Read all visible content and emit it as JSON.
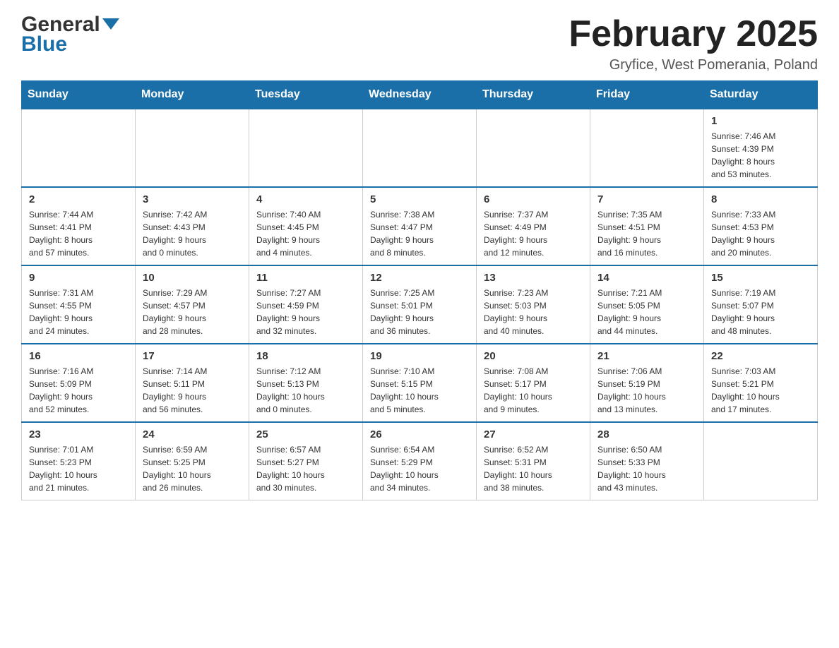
{
  "header": {
    "logo_general": "General",
    "logo_blue": "Blue",
    "title": "February 2025",
    "subtitle": "Gryfice, West Pomerania, Poland"
  },
  "weekdays": [
    "Sunday",
    "Monday",
    "Tuesday",
    "Wednesday",
    "Thursday",
    "Friday",
    "Saturday"
  ],
  "weeks": [
    [
      {
        "day": "",
        "info": ""
      },
      {
        "day": "",
        "info": ""
      },
      {
        "day": "",
        "info": ""
      },
      {
        "day": "",
        "info": ""
      },
      {
        "day": "",
        "info": ""
      },
      {
        "day": "",
        "info": ""
      },
      {
        "day": "1",
        "info": "Sunrise: 7:46 AM\nSunset: 4:39 PM\nDaylight: 8 hours\nand 53 minutes."
      }
    ],
    [
      {
        "day": "2",
        "info": "Sunrise: 7:44 AM\nSunset: 4:41 PM\nDaylight: 8 hours\nand 57 minutes."
      },
      {
        "day": "3",
        "info": "Sunrise: 7:42 AM\nSunset: 4:43 PM\nDaylight: 9 hours\nand 0 minutes."
      },
      {
        "day": "4",
        "info": "Sunrise: 7:40 AM\nSunset: 4:45 PM\nDaylight: 9 hours\nand 4 minutes."
      },
      {
        "day": "5",
        "info": "Sunrise: 7:38 AM\nSunset: 4:47 PM\nDaylight: 9 hours\nand 8 minutes."
      },
      {
        "day": "6",
        "info": "Sunrise: 7:37 AM\nSunset: 4:49 PM\nDaylight: 9 hours\nand 12 minutes."
      },
      {
        "day": "7",
        "info": "Sunrise: 7:35 AM\nSunset: 4:51 PM\nDaylight: 9 hours\nand 16 minutes."
      },
      {
        "day": "8",
        "info": "Sunrise: 7:33 AM\nSunset: 4:53 PM\nDaylight: 9 hours\nand 20 minutes."
      }
    ],
    [
      {
        "day": "9",
        "info": "Sunrise: 7:31 AM\nSunset: 4:55 PM\nDaylight: 9 hours\nand 24 minutes."
      },
      {
        "day": "10",
        "info": "Sunrise: 7:29 AM\nSunset: 4:57 PM\nDaylight: 9 hours\nand 28 minutes."
      },
      {
        "day": "11",
        "info": "Sunrise: 7:27 AM\nSunset: 4:59 PM\nDaylight: 9 hours\nand 32 minutes."
      },
      {
        "day": "12",
        "info": "Sunrise: 7:25 AM\nSunset: 5:01 PM\nDaylight: 9 hours\nand 36 minutes."
      },
      {
        "day": "13",
        "info": "Sunrise: 7:23 AM\nSunset: 5:03 PM\nDaylight: 9 hours\nand 40 minutes."
      },
      {
        "day": "14",
        "info": "Sunrise: 7:21 AM\nSunset: 5:05 PM\nDaylight: 9 hours\nand 44 minutes."
      },
      {
        "day": "15",
        "info": "Sunrise: 7:19 AM\nSunset: 5:07 PM\nDaylight: 9 hours\nand 48 minutes."
      }
    ],
    [
      {
        "day": "16",
        "info": "Sunrise: 7:16 AM\nSunset: 5:09 PM\nDaylight: 9 hours\nand 52 minutes."
      },
      {
        "day": "17",
        "info": "Sunrise: 7:14 AM\nSunset: 5:11 PM\nDaylight: 9 hours\nand 56 minutes."
      },
      {
        "day": "18",
        "info": "Sunrise: 7:12 AM\nSunset: 5:13 PM\nDaylight: 10 hours\nand 0 minutes."
      },
      {
        "day": "19",
        "info": "Sunrise: 7:10 AM\nSunset: 5:15 PM\nDaylight: 10 hours\nand 5 minutes."
      },
      {
        "day": "20",
        "info": "Sunrise: 7:08 AM\nSunset: 5:17 PM\nDaylight: 10 hours\nand 9 minutes."
      },
      {
        "day": "21",
        "info": "Sunrise: 7:06 AM\nSunset: 5:19 PM\nDaylight: 10 hours\nand 13 minutes."
      },
      {
        "day": "22",
        "info": "Sunrise: 7:03 AM\nSunset: 5:21 PM\nDaylight: 10 hours\nand 17 minutes."
      }
    ],
    [
      {
        "day": "23",
        "info": "Sunrise: 7:01 AM\nSunset: 5:23 PM\nDaylight: 10 hours\nand 21 minutes."
      },
      {
        "day": "24",
        "info": "Sunrise: 6:59 AM\nSunset: 5:25 PM\nDaylight: 10 hours\nand 26 minutes."
      },
      {
        "day": "25",
        "info": "Sunrise: 6:57 AM\nSunset: 5:27 PM\nDaylight: 10 hours\nand 30 minutes."
      },
      {
        "day": "26",
        "info": "Sunrise: 6:54 AM\nSunset: 5:29 PM\nDaylight: 10 hours\nand 34 minutes."
      },
      {
        "day": "27",
        "info": "Sunrise: 6:52 AM\nSunset: 5:31 PM\nDaylight: 10 hours\nand 38 minutes."
      },
      {
        "day": "28",
        "info": "Sunrise: 6:50 AM\nSunset: 5:33 PM\nDaylight: 10 hours\nand 43 minutes."
      },
      {
        "day": "",
        "info": ""
      }
    ]
  ]
}
